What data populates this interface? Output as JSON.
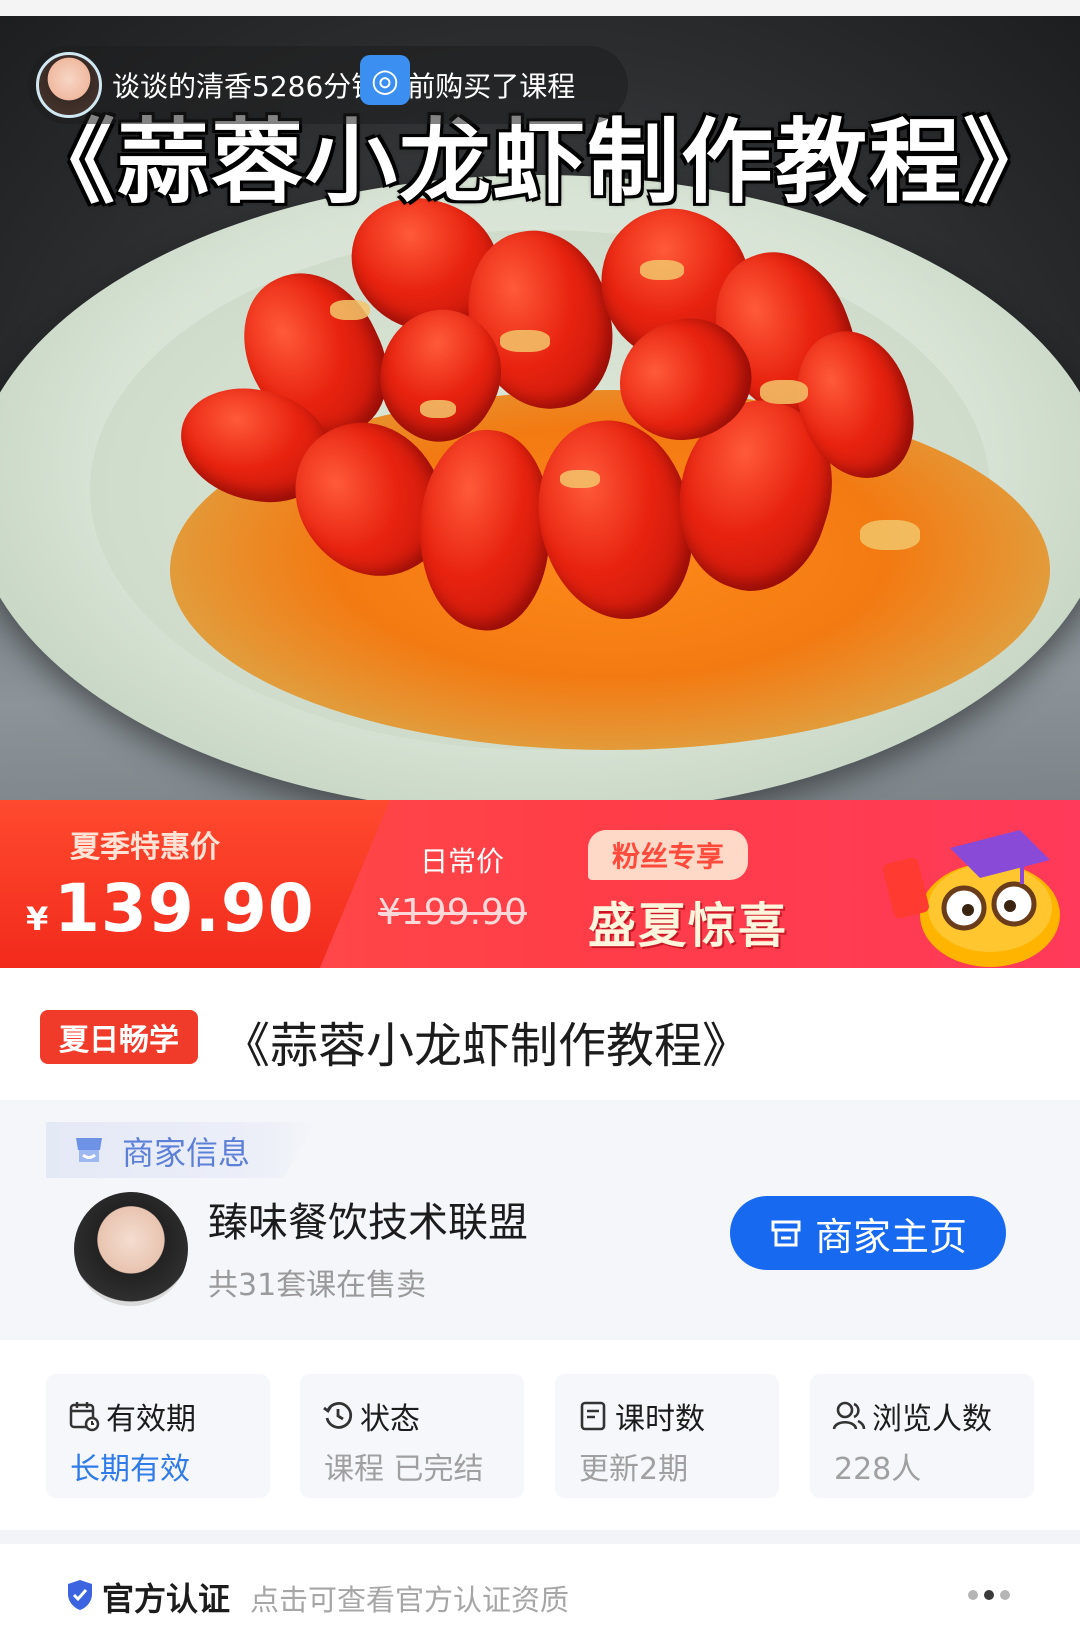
{
  "hero": {
    "title": "《蒜蓉小龙虾制作教程》",
    "buyer_notice": "谈谈的清香5286分钟之前购买了课程"
  },
  "price_banner": {
    "sale_label": "夏季特惠价",
    "currency": "¥",
    "sale_price": "139.90",
    "regular_label": "日常价",
    "regular_price": "¥199.90",
    "fans_badge": "粉丝专享",
    "promo_text": "盛夏惊喜"
  },
  "course": {
    "tag": "夏日畅学",
    "title": "《蒜蓉小龙虾制作教程》"
  },
  "merchant": {
    "section_label": "商家信息",
    "name": "臻味餐饮技术联盟",
    "course_count": "共31套课在售卖",
    "home_button": "商家主页"
  },
  "stats": [
    {
      "title": "有效期",
      "value": "长期有效",
      "icon": "calendar-icon",
      "accent": true
    },
    {
      "title": "状态",
      "value": "课程 已完结",
      "icon": "history-icon",
      "accent": false
    },
    {
      "title": "课时数",
      "value": "更新2期",
      "icon": "document-icon",
      "accent": false
    },
    {
      "title": "浏览人数",
      "value": "228人",
      "icon": "users-icon",
      "accent": false
    }
  ],
  "certification": {
    "label": "官方认证",
    "description": "点击可查看官方认证资质"
  },
  "colors": {
    "brand_blue": "#1769f0",
    "sale_red": "#f22a1c",
    "tag_red": "#f03a2a",
    "accent_value_blue": "#2f7be8"
  }
}
